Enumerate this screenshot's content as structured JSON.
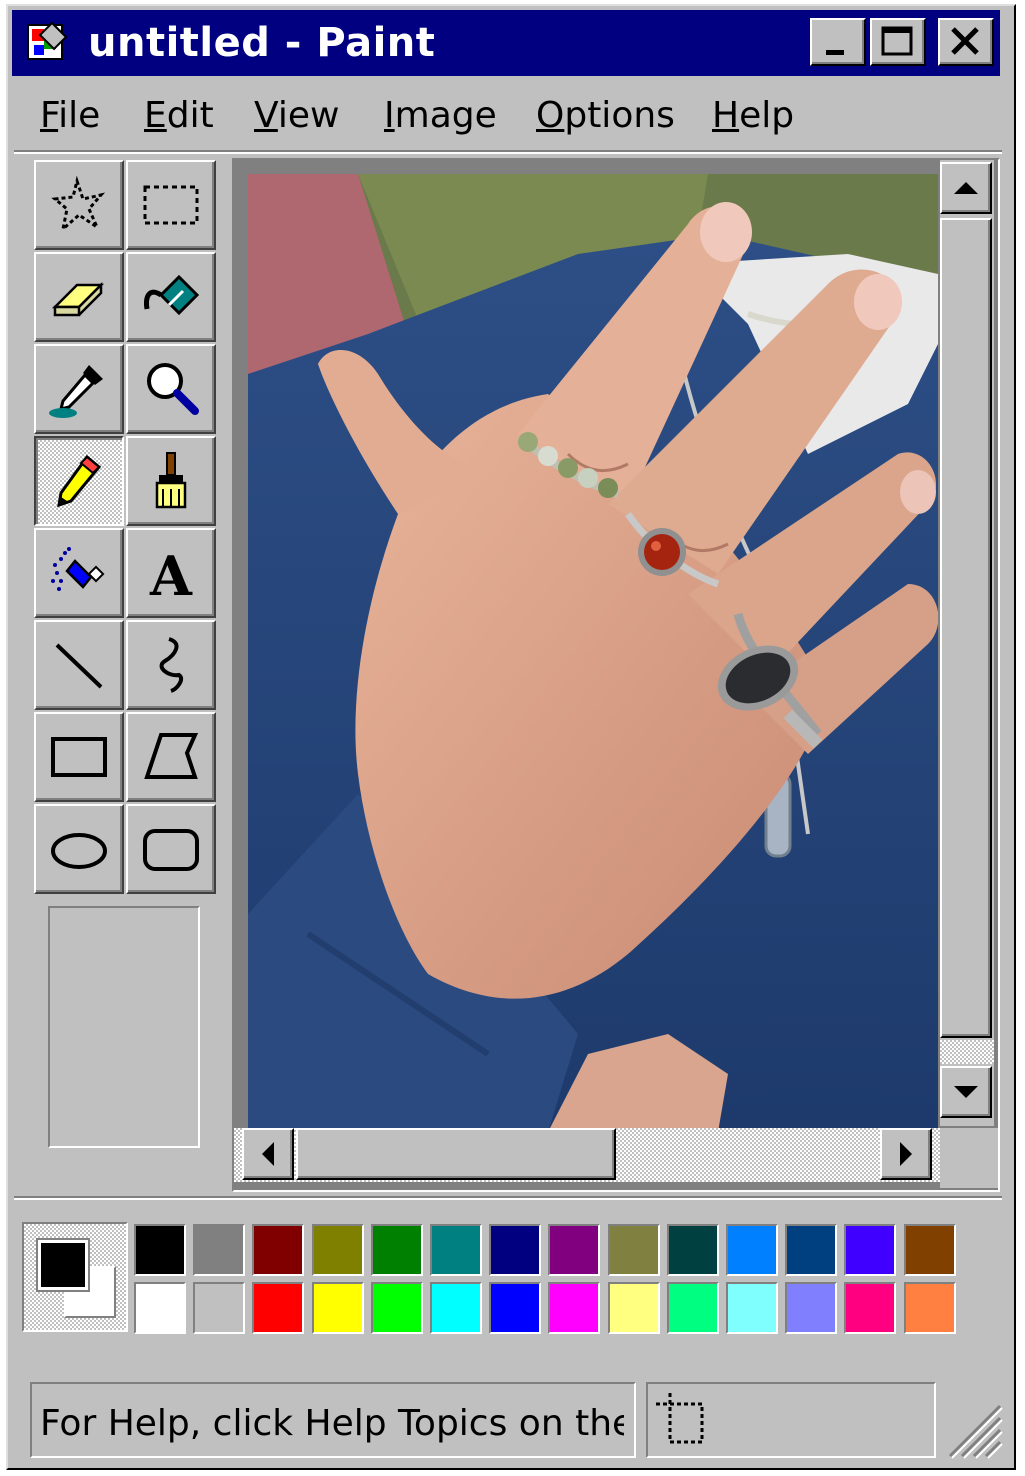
{
  "window": {
    "title": "untitled - Paint"
  },
  "title_buttons": {
    "minimize": "minimize-icon",
    "maximize": "maximize-icon",
    "close": "close-icon"
  },
  "menu": [
    {
      "label": "File"
    },
    {
      "label": "Edit"
    },
    {
      "label": "View"
    },
    {
      "label": "Image"
    },
    {
      "label": "Options"
    },
    {
      "label": "Help"
    }
  ],
  "tools": [
    {
      "name": "free-form-select-icon"
    },
    {
      "name": "rect-select-icon"
    },
    {
      "name": "eraser-icon"
    },
    {
      "name": "fill-bucket-icon"
    },
    {
      "name": "pick-color-icon"
    },
    {
      "name": "magnifier-icon"
    },
    {
      "name": "pencil-icon",
      "selected": true
    },
    {
      "name": "brush-icon"
    },
    {
      "name": "airbrush-icon"
    },
    {
      "name": "text-icon",
      "glyph": "A"
    },
    {
      "name": "line-icon"
    },
    {
      "name": "curve-icon"
    },
    {
      "name": "rectangle-icon"
    },
    {
      "name": "polygon-icon"
    },
    {
      "name": "ellipse-icon"
    },
    {
      "name": "rounded-rect-icon"
    }
  ],
  "colors": {
    "foreground": "#000000",
    "background": "#ffffff",
    "palette_top": [
      "#000000",
      "#808080",
      "#800000",
      "#808000",
      "#008000",
      "#008080",
      "#000080",
      "#800080",
      "#808040",
      "#004040",
      "#0080ff",
      "#004080",
      "#4000ff",
      "#804000"
    ],
    "palette_bottom": [
      "#ffffff",
      "#c0c0c0",
      "#ff0000",
      "#ffff00",
      "#00ff00",
      "#00ffff",
      "#0000ff",
      "#ff00ff",
      "#ffff80",
      "#00ff80",
      "#80ffff",
      "#8080ff",
      "#ff0080",
      "#ff8040"
    ]
  },
  "status": {
    "help_text": "For Help, click Help Topics on the Help Menu."
  }
}
